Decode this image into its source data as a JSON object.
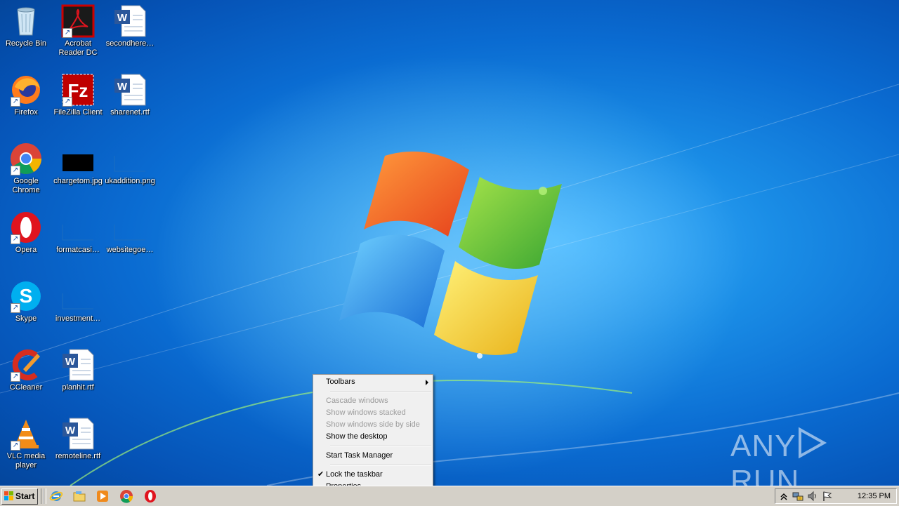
{
  "desktop": {
    "icons": [
      {
        "label": "Recycle Bin"
      },
      {
        "label": "Acrobat Reader DC"
      },
      {
        "label": "secondhere…"
      },
      {
        "label": "Firefox"
      },
      {
        "label": "FileZilla Client"
      },
      {
        "label": "sharenet.rtf"
      },
      {
        "label": "Google Chrome"
      },
      {
        "label": "chargetom.jpg"
      },
      {
        "label": "ukaddition.png"
      },
      {
        "label": "Opera"
      },
      {
        "label": "formatcasi…"
      },
      {
        "label": "websitegoe…"
      },
      {
        "label": "Skype"
      },
      {
        "label": "investment…"
      },
      {
        "label": "CCleaner"
      },
      {
        "label": "planhit.rtf"
      },
      {
        "label": "VLC media player"
      },
      {
        "label": "remoteline.rtf"
      }
    ]
  },
  "context_menu": {
    "toolbars": "Toolbars",
    "cascade": "Cascade windows",
    "stacked": "Show windows stacked",
    "side_by_side": "Show windows side by side",
    "show_desktop": "Show the desktop",
    "task_manager": "Start Task Manager",
    "lock_taskbar": "Lock the taskbar",
    "properties": "Properties",
    "check_glyph": "✔"
  },
  "taskbar": {
    "start_label": "Start",
    "clock": "12:35 PM"
  },
  "watermark": {
    "left": "ANY",
    "right": "RUN"
  },
  "colors": {
    "desktop_blue": "#0a6bd1",
    "taskbar_gray": "#d4d0c8",
    "disabled_text": "#9a9a9a"
  }
}
